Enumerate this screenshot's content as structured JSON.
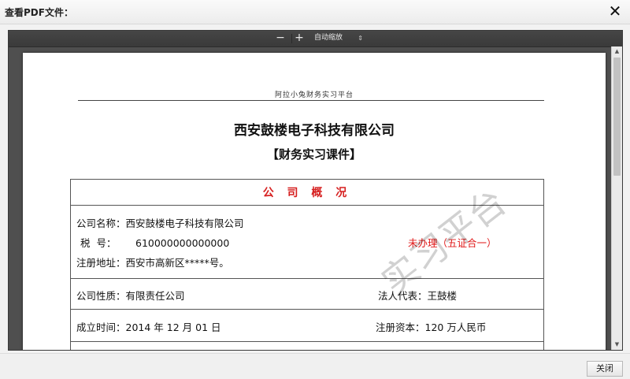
{
  "dialog": {
    "title": "查看PDF文件：",
    "close_icon": "✕",
    "close_button_label": "关闭"
  },
  "viewer_toolbar": {
    "zoom_out": "−",
    "zoom_in": "+",
    "zoom_select": "自动缩放",
    "zoom_caret": "⇕"
  },
  "document": {
    "header_small": "阿拉小兔财务实习平台",
    "company_title": "西安鼓楼电子科技有限公司",
    "course_title": "【财务实习课件】",
    "section_title": "公 司 概 况",
    "fields": {
      "company_name_label": "公司名称：",
      "company_name": "西安鼓楼电子科技有限公司",
      "tax_label": "税  号：",
      "tax_number": "610000000000000",
      "address_label": "注册地址：",
      "address": "西安市高新区*****号。",
      "status": "未办理（五证合一）",
      "nature_label": "公司性质：",
      "nature": "有限责任公司",
      "legal_rep_label": "法人代表：",
      "legal_rep": "王鼓楼",
      "established_label": "成立时间：",
      "established": "2014 年 12 月 01 日",
      "capital_label": "注册资本：",
      "capital": "120 万人民币"
    },
    "watermark": "实习平台"
  },
  "colors": {
    "accent_red": "#d62020",
    "viewer_bg": "#4f4f4f"
  }
}
